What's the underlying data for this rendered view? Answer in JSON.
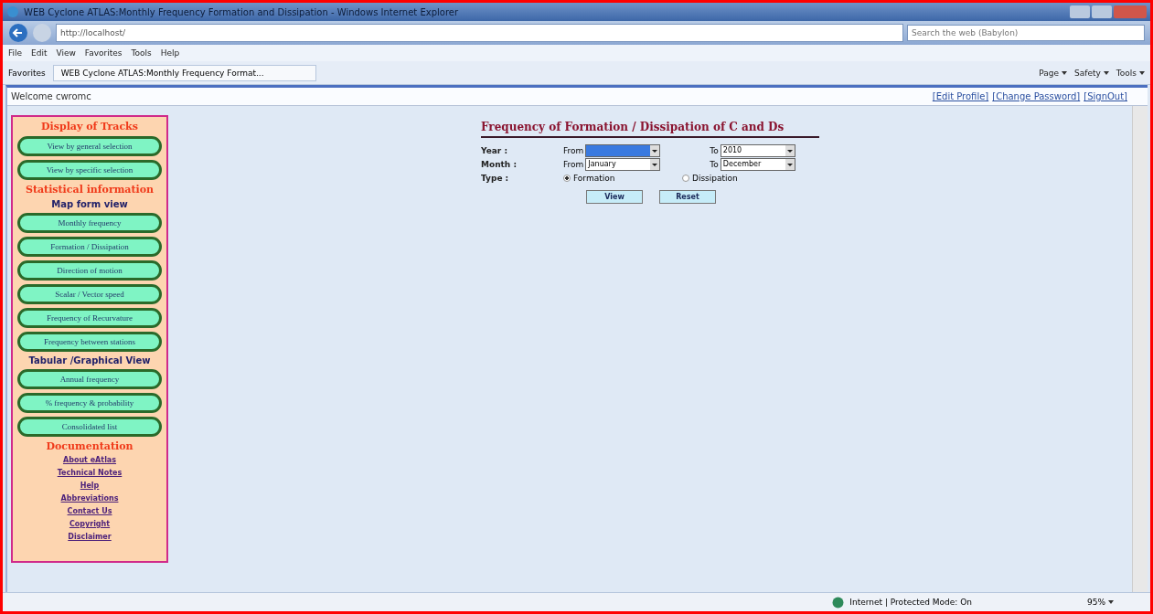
{
  "window": {
    "title": "WEB Cyclone ATLAS:Monthly Frequency Formation and Dissipation - Windows Internet Explorer"
  },
  "address": {
    "url": "http://localhost/"
  },
  "search": {
    "placeholder": "Search the web (Babylon)"
  },
  "menu": [
    "File",
    "Edit",
    "View",
    "Favorites",
    "Tools",
    "Help"
  ],
  "favorites": {
    "label": "Favorites",
    "tab": "WEB Cyclone ATLAS:Monthly Frequency Format..."
  },
  "command_bar": [
    "Page",
    "Safety",
    "Tools"
  ],
  "welcome": "Welcome cwromc",
  "user_links": [
    "[Edit Profile]",
    "[Change Password]",
    "[SignOut]"
  ],
  "sidebar": [
    {
      "kind": "heading",
      "label": "Display of Tracks"
    },
    {
      "kind": "button",
      "label": "View by general selection"
    },
    {
      "kind": "button",
      "label": "View by specific selection"
    },
    {
      "kind": "heading",
      "label": "Statistical information"
    },
    {
      "kind": "subheading",
      "label": "Map form view"
    },
    {
      "kind": "button",
      "label": "Monthly frequency"
    },
    {
      "kind": "button",
      "label": "Formation / Dissipation"
    },
    {
      "kind": "button",
      "label": "Direction of motion"
    },
    {
      "kind": "button",
      "label": "Scalar / Vector speed"
    },
    {
      "kind": "button",
      "label": "Frequency of Recurvature"
    },
    {
      "kind": "button",
      "label": "Frequency between stations"
    },
    {
      "kind": "subheading",
      "label": "Tabular /Graphical View"
    },
    {
      "kind": "button",
      "label": "Annual frequency"
    },
    {
      "kind": "button",
      "label": "% frequency & probability"
    },
    {
      "kind": "button",
      "label": "Consolidated list"
    },
    {
      "kind": "heading",
      "label": "Documentation"
    },
    {
      "kind": "link",
      "label": "About eAtlas"
    },
    {
      "kind": "link",
      "label": "Technical Notes"
    },
    {
      "kind": "link",
      "label": "Help"
    },
    {
      "kind": "link",
      "label": "Abbreviations"
    },
    {
      "kind": "link",
      "label": "Contact Us"
    },
    {
      "kind": "link",
      "label": "Copyright"
    },
    {
      "kind": "link",
      "label": "Disclaimer"
    }
  ],
  "form": {
    "title": "Frequency of Formation / Dissipation of C and Ds",
    "rows": [
      {
        "label": "Year :",
        "from_label": "From",
        "from": {
          "highlighted": true
        },
        "to_label": "To",
        "to": {
          "value": "2010",
          "highlighted": false
        }
      },
      {
        "label": "Month :",
        "from_label": "From",
        "from": {
          "value": "January",
          "highlighted": false
        },
        "to_label": "To",
        "to": {
          "value": "December",
          "highlighted": false
        }
      }
    ],
    "type_label": "Type :",
    "types": [
      {
        "label": "Formation",
        "selected": true
      },
      {
        "label": "Dissipation",
        "selected": false
      }
    ],
    "buttons": [
      "View",
      "Reset"
    ]
  },
  "status_bar": {
    "zone": "Internet | Protected Mode: On",
    "zoom": "95%"
  }
}
